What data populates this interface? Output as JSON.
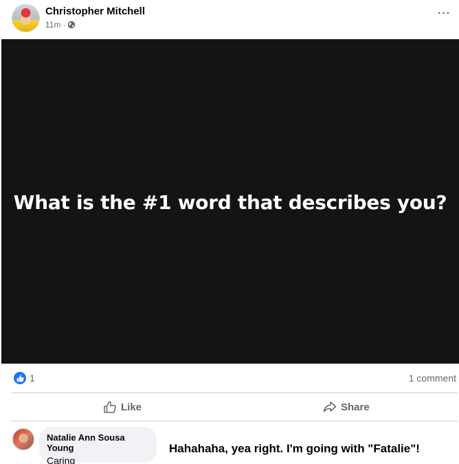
{
  "post": {
    "author": "Christopher Mitchell",
    "time": "11m",
    "separator": "·",
    "more_label": "···",
    "media_text": "What is the #1 word that describes you?"
  },
  "stats": {
    "like_count": "1",
    "comment_count": "1 comment"
  },
  "actions": {
    "like_label": "Like",
    "share_label": "Share"
  },
  "comment": {
    "author": "Natalie Ann Sousa Young",
    "text": "Caring"
  },
  "overlay": {
    "reply_text": "Hahahaha, yea right. I'm going with \"Fatalie\"!"
  },
  "colors": {
    "accent": "#1877f2",
    "media_bg": "#141414",
    "muted_text": "#65676b",
    "bubble_bg": "#f0f2f5"
  },
  "icons": [
    "globe-icon",
    "more-icon",
    "like-reaction-icon",
    "thumbs-up-icon",
    "share-arrow-icon"
  ]
}
